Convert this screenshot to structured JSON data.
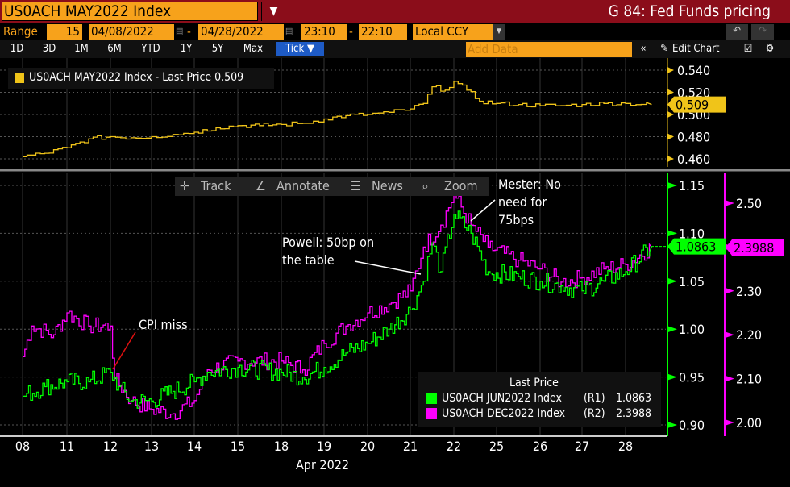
{
  "header": {
    "security": "US0ACH MAY2022 Index",
    "title": "G 84: Fed Funds pricing"
  },
  "range": {
    "label": "Range",
    "period": "15",
    "start": "04/08/2022",
    "end": "04/28/2022",
    "time_start": "23:10",
    "time_end": "22:10",
    "currency": "Local CCY",
    "dash": "-"
  },
  "toolbar": {
    "periods": [
      "1D",
      "3D",
      "1M",
      "6M",
      "YTD",
      "1Y",
      "5Y",
      "Max"
    ],
    "tick": "Tick ▼",
    "add_data_placeholder": "Add Data",
    "collapse": "«",
    "edit_chart": "Edit Chart"
  },
  "chart_tools": {
    "track": "Track",
    "annotate": "Annotate",
    "news": "News",
    "zoom": "Zoom"
  },
  "colors": {
    "may": "#f0c419",
    "jun": "#00ff00",
    "dec": "#ff00ff",
    "accent": "#f7a21b",
    "titlebar": "#8b0d1a"
  },
  "chart_data": [
    {
      "type": "line",
      "panel": "upper",
      "legend": "US0ACH MAY2022 Index - Last Price  0.509",
      "series": [
        {
          "name": "US0ACH MAY2022 Index",
          "last": "0.509",
          "x": [
            0,
            0.5,
            1,
            1.5,
            2,
            2.5,
            3,
            3.5,
            4,
            4.5,
            5,
            5.5,
            6,
            6.5,
            7,
            7.5,
            8,
            8.5,
            9,
            9.3,
            9.5,
            9.8,
            10,
            10.3,
            10.6,
            11,
            11.5,
            12,
            12.5,
            13,
            13.5,
            14,
            14.6
          ],
          "values": [
            0.462,
            0.465,
            0.47,
            0.478,
            0.48,
            0.479,
            0.48,
            0.482,
            0.484,
            0.488,
            0.49,
            0.49,
            0.491,
            0.492,
            0.496,
            0.499,
            0.5,
            0.502,
            0.505,
            0.51,
            0.525,
            0.522,
            0.53,
            0.522,
            0.512,
            0.51,
            0.509,
            0.508,
            0.508,
            0.509,
            0.51,
            0.51,
            0.509
          ]
        }
      ],
      "yticks": [
        "0.540",
        "0.520",
        "0.500",
        "0.480",
        "0.460"
      ],
      "ylim": [
        0.455,
        0.545
      ]
    },
    {
      "type": "line",
      "panel": "lower",
      "legend_title": "Last Price",
      "series": [
        {
          "name": "US0ACH JUN2022 Index",
          "axis": "(R1)",
          "last": "1.0863",
          "x": [
            0,
            0.5,
            1,
            1.5,
            2,
            2.2,
            2.5,
            3,
            3.5,
            4,
            4.3,
            5,
            6,
            6.5,
            7,
            7.5,
            8,
            8.5,
            9,
            9.3,
            9.5,
            9.7,
            10,
            10.4,
            10.8,
            11.5,
            12,
            12.5,
            13,
            13.5,
            14,
            14.6
          ],
          "values": [
            0.93,
            0.94,
            0.945,
            0.945,
            0.955,
            0.94,
            0.925,
            0.925,
            0.935,
            0.945,
            0.955,
            0.96,
            0.955,
            0.95,
            0.96,
            0.975,
            0.985,
            1.0,
            1.02,
            1.05,
            1.09,
            1.06,
            1.12,
            1.1,
            1.06,
            1.055,
            1.05,
            1.045,
            1.04,
            1.05,
            1.06,
            1.086
          ]
        },
        {
          "name": "US0ACH DEC2022 Index",
          "axis": "(R2)",
          "last": "2.3988",
          "x": [
            0,
            0.2,
            0.7,
            1,
            1.5,
            2,
            2.1,
            2.5,
            3,
            3.5,
            4,
            4.3,
            5,
            6,
            6.5,
            7,
            7.5,
            8,
            8.5,
            9,
            9.3,
            9.7,
            10,
            10.4,
            10.8,
            11.5,
            12,
            12.5,
            13,
            13.5,
            14,
            14.6
          ],
          "values": [
            2.15,
            2.22,
            2.2,
            2.25,
            2.22,
            2.22,
            2.1,
            2.05,
            2.03,
            2.02,
            2.05,
            2.12,
            2.14,
            2.14,
            2.12,
            2.18,
            2.22,
            2.25,
            2.27,
            2.3,
            2.4,
            2.45,
            2.52,
            2.45,
            2.4,
            2.37,
            2.35,
            2.32,
            2.33,
            2.35,
            2.36,
            2.4
          ]
        }
      ],
      "y1ticks": [
        "1.15",
        "1.10",
        "1.05",
        "1.00",
        "0.95",
        "0.90"
      ],
      "y1lim": [
        0.885,
        1.165
      ],
      "y2ticks": [
        "2.50",
        "2.40",
        "2.30",
        "2.20",
        "2.10",
        "2.00"
      ],
      "y2lim": [
        1.995,
        2.54
      ],
      "annotations": [
        {
          "text": "CPI miss",
          "x": 2
        },
        {
          "text": "Powell: 50bp on the table",
          "x": 9.3
        },
        {
          "text": "Mester: No need for 75bps",
          "x": 10.4
        }
      ]
    },
    {
      "xticks": [
        "08",
        "11",
        "12",
        "13",
        "14",
        "15",
        "18",
        "19",
        "20",
        "21",
        "22",
        "25",
        "26",
        "27",
        "28"
      ],
      "xlabel": "Apr 2022"
    }
  ]
}
